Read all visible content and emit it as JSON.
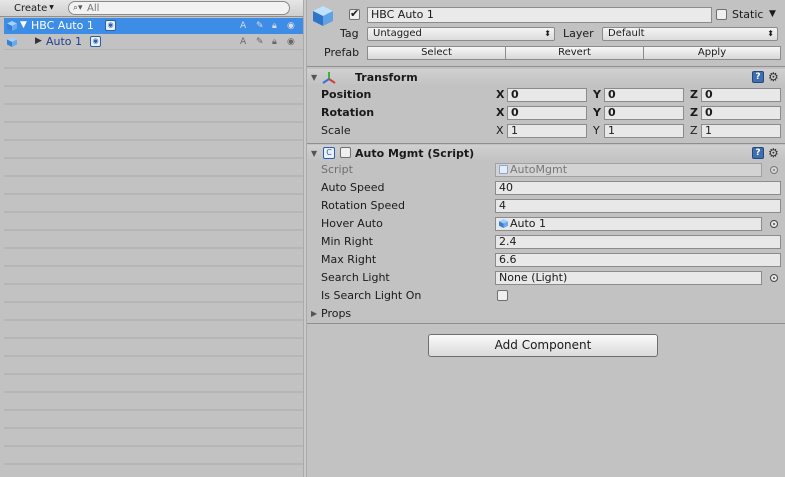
{
  "hierarchy": {
    "create_label": "Create",
    "search_placeholder": "All",
    "items": [
      {
        "name": "HBC Auto 1",
        "selected": true,
        "expanded": true,
        "layer_letter": "A"
      },
      {
        "name": "Auto 1",
        "selected": false,
        "expanded": false,
        "layer_letter": "A"
      }
    ]
  },
  "inspector": {
    "object_name": "HBC Auto 1",
    "active": true,
    "static_label": "Static",
    "static": false,
    "tag_label": "Tag",
    "tag_value": "Untagged",
    "layer_label": "Layer",
    "layer_value": "Default",
    "prefab_label": "Prefab",
    "prefab_buttons": {
      "select": "Select",
      "revert": "Revert",
      "apply": "Apply"
    },
    "transform": {
      "title": "Transform",
      "rows": [
        {
          "label": "Position",
          "x": "0",
          "y": "0",
          "z": "0"
        },
        {
          "label": "Rotation",
          "x": "0",
          "y": "0",
          "z": "0"
        },
        {
          "label": "Scale",
          "x": "1",
          "y": "1",
          "z": "1"
        }
      ],
      "axis_labels": {
        "x": "X",
        "y": "Y",
        "z": "Z"
      }
    },
    "script_component": {
      "title": "Auto Mgmt (Script)",
      "enabled": false,
      "fields": [
        {
          "label": "Script",
          "value": "AutoMgmt",
          "readonly": true
        },
        {
          "label": "Auto Speed",
          "value": "40"
        },
        {
          "label": "Rotation Speed",
          "value": "4"
        },
        {
          "label": "Hover Auto",
          "value": "Auto 1",
          "object_ref": true
        },
        {
          "label": "Min Right",
          "value": "2.4"
        },
        {
          "label": "Max Right",
          "value": "6.6"
        },
        {
          "label": "Search Light",
          "value": "None (Light)",
          "object_ref": true
        },
        {
          "label": "Is Search Light On",
          "value": "",
          "checkbox": true,
          "checked": false
        }
      ],
      "foldout_label": "Props"
    },
    "add_component_label": "Add Component"
  },
  "colors": {
    "selection": "#3d8ce6",
    "panel_bg": "#c2c2c2",
    "field_bg": "#e8e8e8",
    "link_text": "#1f3f8c"
  }
}
